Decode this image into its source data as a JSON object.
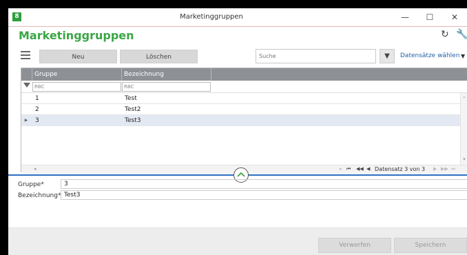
{
  "window": {
    "title": "Marketinggruppen",
    "minimize": "—",
    "maximize": "☐",
    "close": "✕"
  },
  "heading": "Marketinggruppen",
  "toolbar": {
    "new_label": "Neu",
    "delete_label": "Löschen",
    "search_placeholder": "Suche",
    "select_records_label": "Datensätze wählen"
  },
  "grid": {
    "columns": [
      "Gruppe",
      "Bezeichnung"
    ],
    "filter_placeholders": [
      "RBC",
      "RBC"
    ],
    "rows": [
      {
        "gruppe": "1",
        "bezeichnung": "Test",
        "selected": false
      },
      {
        "gruppe": "2",
        "bezeichnung": "Test2",
        "selected": false
      },
      {
        "gruppe": "3",
        "bezeichnung": "Test3",
        "selected": true
      }
    ],
    "pager": {
      "text": "Datensatz 3 von 3"
    }
  },
  "form": {
    "gruppe_label": "Gruppe*",
    "gruppe_value": "3",
    "bezeichnung_label": "Bezeichnung*",
    "bezeichnung_value": "Test3"
  },
  "buttons": {
    "discard": "Verwerfen",
    "save": "Speichern"
  },
  "colors": {
    "accent_green": "#3aa645",
    "header_gray": "#8d9196",
    "link_blue": "#1f5fa8",
    "splitter_blue": "#2c6fc0",
    "selected_row": "#e3e9f3"
  }
}
